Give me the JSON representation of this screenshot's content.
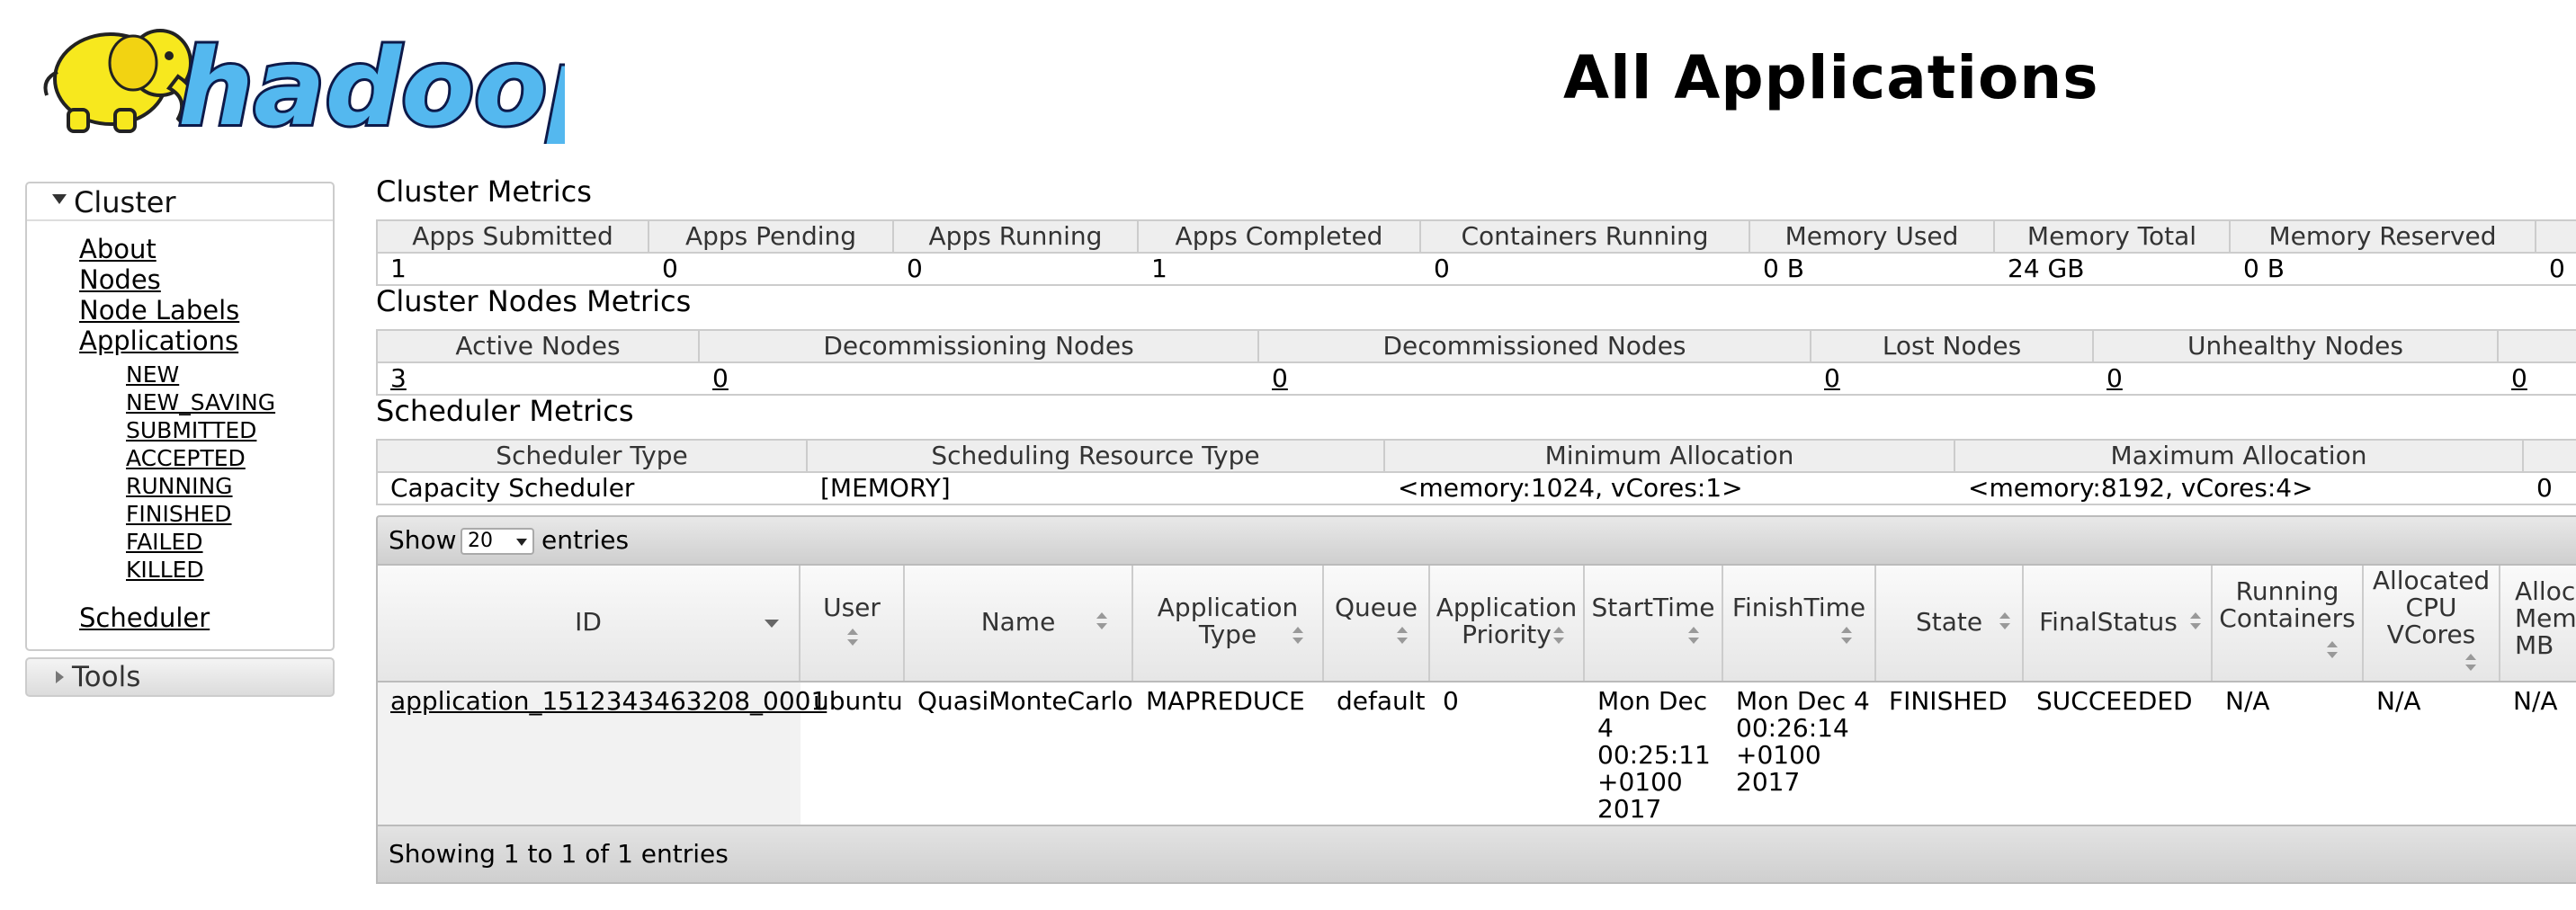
{
  "header": {
    "logo_text": "hadoop",
    "title": "All Applications"
  },
  "sidebar": {
    "cluster_label": "Cluster",
    "items": [
      "About",
      "Nodes",
      "Node Labels",
      "Applications"
    ],
    "app_states": [
      "NEW",
      "NEW_SAVING",
      "SUBMITTED",
      "ACCEPTED",
      "RUNNING",
      "FINISHED",
      "FAILED",
      "KILLED"
    ],
    "scheduler_label": "Scheduler",
    "tools_label": "Tools"
  },
  "cluster_metrics": {
    "title": "Cluster Metrics",
    "headers": [
      "Apps Submitted",
      "Apps Pending",
      "Apps Running",
      "Apps Completed",
      "Containers Running",
      "Memory Used",
      "Memory Total",
      "Memory Reserved"
    ],
    "values": [
      "1",
      "0",
      "0",
      "1",
      "0",
      "0 B",
      "24 GB",
      "0 B",
      "0"
    ]
  },
  "cluster_nodes_metrics": {
    "title": "Cluster Nodes Metrics",
    "headers": [
      "Active Nodes",
      "Decommissioning Nodes",
      "Decommissioned Nodes",
      "Lost Nodes",
      "Unhealthy Nodes"
    ],
    "values": [
      "3",
      "0",
      "0",
      "0",
      "0",
      "0"
    ]
  },
  "scheduler_metrics": {
    "title": "Scheduler Metrics",
    "headers": [
      "Scheduler Type",
      "Scheduling Resource Type",
      "Minimum Allocation",
      "Maximum Allocation"
    ],
    "values": [
      "Capacity Scheduler",
      "[MEMORY]",
      "<memory:1024, vCores:1>",
      "<memory:8192, vCores:4>",
      "0"
    ]
  },
  "apps_table": {
    "show_label": "Show",
    "entries_label": "entries",
    "page_length": "20",
    "columns": [
      "ID",
      "User",
      "Name",
      "Application\nType",
      "Queue",
      "Application\nPriority",
      "StartTime",
      "FinishTime",
      "State",
      "FinalStatus",
      "Running\nContainers",
      "Allocated\nCPU\nVCores",
      "Alloca\nMem\nMB"
    ],
    "rows": [
      {
        "id": "application_1512343463208_0001",
        "user": "ubuntu",
        "name": "QuasiMonteCarlo",
        "type": "MAPREDUCE",
        "queue": "default",
        "priority": "0",
        "start_time": "Mon Dec\n4\n00:25:11\n+0100\n2017",
        "finish_time": "Mon Dec 4\n00:26:14\n+0100\n2017",
        "state": "FINISHED",
        "final_status": "SUCCEEDED",
        "running_containers": "N/A",
        "allocated_vcores": "N/A",
        "allocated_mem": "N/A"
      }
    ],
    "info": "Showing 1 to 1 of 1 entries"
  }
}
